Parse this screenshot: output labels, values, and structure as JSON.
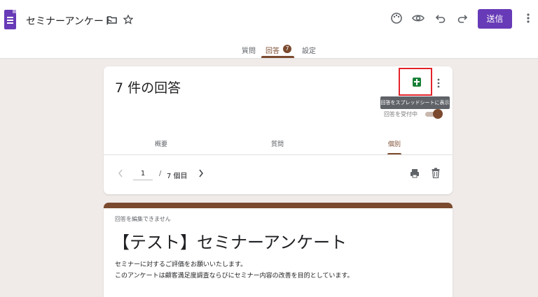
{
  "header": {
    "doc_title": "セミナーアンケート",
    "send_label": "送信",
    "icons": [
      "forms-app-icon",
      "folder-icon",
      "star-icon",
      "palette-icon",
      "preview-eye-icon",
      "undo-icon",
      "redo-icon",
      "more-vert-icon"
    ]
  },
  "tabs": [
    {
      "label": "質問",
      "active": false
    },
    {
      "label": "回答",
      "active": true,
      "badge": "7"
    },
    {
      "label": "設定",
      "active": false
    }
  ],
  "responses": {
    "count_title": "7 件の回答",
    "tooltip": "回答をスプレッドシートに表示",
    "accepting_label": "回答を受付中",
    "accepting": true,
    "subtabs": [
      {
        "label": "概要",
        "active": false
      },
      {
        "label": "質問",
        "active": false
      },
      {
        "label": "個別",
        "active": true
      }
    ],
    "pager": {
      "current": "1",
      "separator": "/",
      "total": "7 個目"
    }
  },
  "form": {
    "cannot_edit": "回答を編集できません",
    "title": "【テスト】セミナーアンケート",
    "description": [
      "セミナーに対するご評価をお願いいたします。",
      "このアンケートは顧客満足度調査ならびにセミナー内容の改善を目的としています。"
    ]
  },
  "colors": {
    "accent": "#7b4a2e",
    "brand": "#673ab7",
    "sheets_green": "#188038",
    "highlight_red": "#e3242b",
    "background": "#f0ebe8"
  }
}
